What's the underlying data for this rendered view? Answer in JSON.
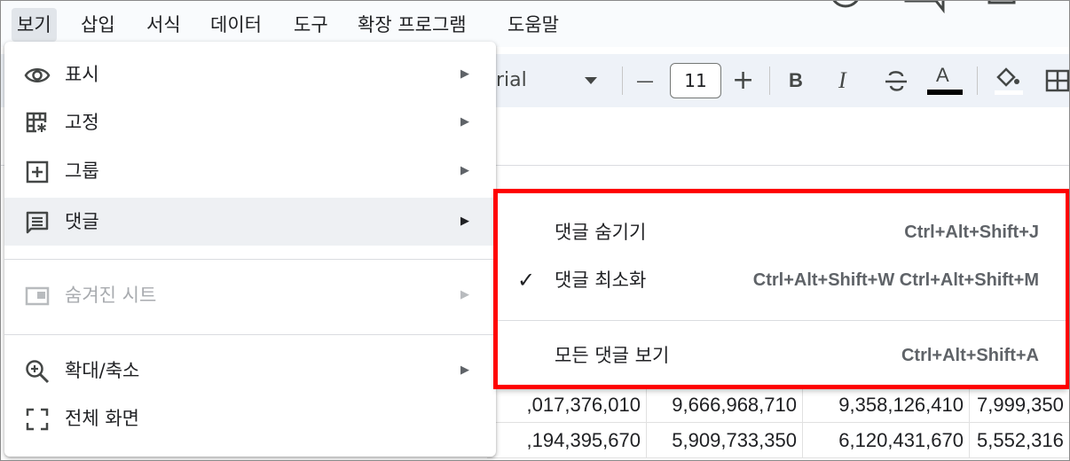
{
  "menubar": {
    "items": [
      {
        "label": "보기",
        "active": true
      },
      {
        "label": "삽입"
      },
      {
        "label": "서식"
      },
      {
        "label": "데이터"
      },
      {
        "label": "도구"
      },
      {
        "label": "확장 프로그램"
      },
      {
        "label": "도움말"
      }
    ]
  },
  "toolbar": {
    "font_name": "rial",
    "minus": "—",
    "font_size": "11",
    "plus": "+",
    "bold": "B",
    "italic": "I",
    "text_color_letter": "A"
  },
  "colors": {
    "highlight_border": "#ff0000",
    "menu_hover": "#eef0f3",
    "disabled_text": "#a8abaf"
  },
  "view_menu": {
    "items": [
      {
        "label": "표시",
        "icon": "eye-icon",
        "arrow": "▶"
      },
      {
        "label": "고정",
        "icon": "freeze-icon",
        "arrow": "▶"
      },
      {
        "label": "그룹",
        "icon": "group-plus-icon",
        "arrow": "▶"
      },
      {
        "label": "댓글",
        "icon": "comment-icon",
        "arrow": "▶",
        "highlighted": true
      },
      {
        "label": "숨겨진 시트",
        "icon": "hidden-sheet-icon",
        "arrow": "▶",
        "disabled": true
      },
      {
        "label": "확대/축소",
        "icon": "zoom-in-icon",
        "arrow": "▶"
      },
      {
        "label": "전체 화면",
        "icon": "fullscreen-icon"
      }
    ]
  },
  "comments_submenu": {
    "items": [
      {
        "label": "댓글 숨기기",
        "shortcut": "Ctrl+Alt+Shift+J",
        "checked": false
      },
      {
        "label": "댓글 최소화",
        "shortcut": "Ctrl+Alt+Shift+W Ctrl+Alt+Shift+M",
        "checked": true,
        "check": "✓"
      },
      {
        "label": "모든 댓글 보기",
        "shortcut": "Ctrl+Alt+Shift+A",
        "checked": false
      }
    ]
  },
  "grid": {
    "rows": [
      [
        ",017,376,010",
        "9,666,968,710",
        "9,358,126,410",
        "7,999,350"
      ],
      [
        ",194,395,670",
        "5,909,733,350",
        "6,120,431,670",
        "5,552,316"
      ]
    ]
  }
}
